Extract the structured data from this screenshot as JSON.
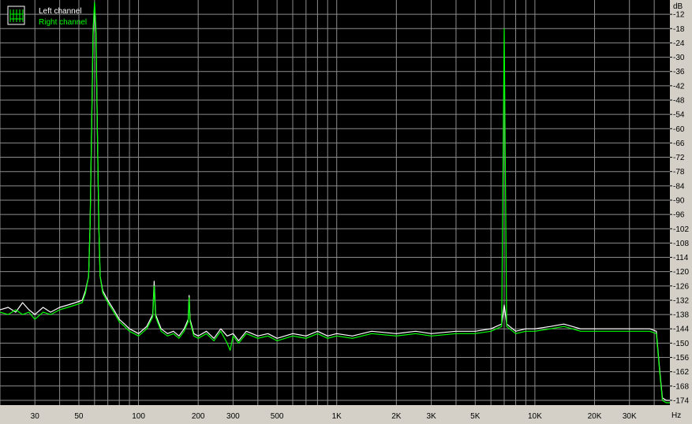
{
  "chart_data": {
    "type": "line",
    "title": "",
    "xlabel": "",
    "ylabel": "",
    "x_scale": "log",
    "xlim": [
      20,
      48000
    ],
    "ylim": [
      -176,
      -6
    ],
    "y_unit_label": "dB",
    "x_unit_label": "Hz",
    "grid": true,
    "background": "#000000",
    "legend_position": "top-left",
    "y_ticks": [
      -12,
      -18,
      -24,
      -30,
      -36,
      -42,
      -48,
      -54,
      -60,
      -66,
      -72,
      -78,
      -84,
      -90,
      -96,
      -102,
      -108,
      -114,
      -120,
      -126,
      -132,
      -138,
      -144,
      -150,
      -156,
      -162,
      -168,
      -174
    ],
    "x_ticks": [
      {
        "value": 30,
        "label": "30"
      },
      {
        "value": 50,
        "label": "50"
      },
      {
        "value": 100,
        "label": "100"
      },
      {
        "value": 200,
        "label": "200"
      },
      {
        "value": 300,
        "label": "300"
      },
      {
        "value": 500,
        "label": "500"
      },
      {
        "value": 1000,
        "label": "1K"
      },
      {
        "value": 2000,
        "label": "2K"
      },
      {
        "value": 3000,
        "label": "3K"
      },
      {
        "value": 5000,
        "label": "5K"
      },
      {
        "value": 10000,
        "label": "10K"
      },
      {
        "value": 20000,
        "label": "20K"
      },
      {
        "value": 30000,
        "label": "30K"
      }
    ],
    "minor_x_gridlines": [
      20,
      40,
      60,
      70,
      80,
      90,
      400,
      600,
      700,
      800,
      900,
      4000,
      6000,
      7000,
      8000,
      9000,
      40000
    ],
    "series": [
      {
        "name": "Left channel",
        "color": "#ffffff",
        "points": [
          [
            20,
            -136
          ],
          [
            22,
            -135
          ],
          [
            24,
            -137
          ],
          [
            26,
            -133
          ],
          [
            28,
            -136
          ],
          [
            30,
            -138
          ],
          [
            33,
            -135
          ],
          [
            36,
            -137
          ],
          [
            40,
            -135
          ],
          [
            44,
            -134
          ],
          [
            48,
            -133
          ],
          [
            52,
            -132
          ],
          [
            54,
            -128
          ],
          [
            56,
            -122
          ],
          [
            57,
            -100
          ],
          [
            58,
            -60
          ],
          [
            59,
            -20
          ],
          [
            60,
            -8
          ],
          [
            61,
            -20
          ],
          [
            62,
            -60
          ],
          [
            63,
            -100
          ],
          [
            64,
            -122
          ],
          [
            66,
            -128
          ],
          [
            70,
            -132
          ],
          [
            75,
            -136
          ],
          [
            80,
            -140
          ],
          [
            85,
            -142
          ],
          [
            90,
            -144
          ],
          [
            95,
            -145
          ],
          [
            100,
            -146
          ],
          [
            110,
            -143
          ],
          [
            118,
            -138
          ],
          [
            120,
            -124
          ],
          [
            122,
            -138
          ],
          [
            130,
            -144
          ],
          [
            140,
            -146
          ],
          [
            150,
            -145
          ],
          [
            160,
            -147
          ],
          [
            170,
            -144
          ],
          [
            178,
            -140
          ],
          [
            180,
            -130
          ],
          [
            182,
            -140
          ],
          [
            190,
            -146
          ],
          [
            200,
            -147
          ],
          [
            220,
            -145
          ],
          [
            240,
            -148
          ],
          [
            260,
            -144
          ],
          [
            280,
            -147
          ],
          [
            300,
            -146
          ],
          [
            320,
            -149
          ],
          [
            350,
            -145
          ],
          [
            400,
            -147
          ],
          [
            450,
            -146
          ],
          [
            500,
            -148
          ],
          [
            600,
            -146
          ],
          [
            700,
            -147
          ],
          [
            800,
            -145
          ],
          [
            900,
            -147
          ],
          [
            1000,
            -146
          ],
          [
            1200,
            -147
          ],
          [
            1500,
            -145
          ],
          [
            2000,
            -146
          ],
          [
            2500,
            -145
          ],
          [
            3000,
            -146
          ],
          [
            4000,
            -145
          ],
          [
            5000,
            -145
          ],
          [
            6000,
            -144
          ],
          [
            6800,
            -142
          ],
          [
            7000,
            -134
          ],
          [
            7200,
            -142
          ],
          [
            8000,
            -145
          ],
          [
            9000,
            -144
          ],
          [
            10000,
            -144
          ],
          [
            12000,
            -143
          ],
          [
            14000,
            -142
          ],
          [
            17000,
            -144
          ],
          [
            20000,
            -144
          ],
          [
            25000,
            -144
          ],
          [
            30000,
            -144
          ],
          [
            38000,
            -144
          ],
          [
            41000,
            -145
          ],
          [
            42500,
            -160
          ],
          [
            44000,
            -173
          ],
          [
            46000,
            -174
          ],
          [
            48000,
            -174
          ]
        ]
      },
      {
        "name": "Right channel",
        "color": "#00ff00",
        "points": [
          [
            20,
            -137
          ],
          [
            22,
            -138
          ],
          [
            24,
            -136
          ],
          [
            26,
            -138
          ],
          [
            28,
            -137
          ],
          [
            30,
            -140
          ],
          [
            33,
            -137
          ],
          [
            36,
            -138
          ],
          [
            40,
            -136
          ],
          [
            44,
            -135
          ],
          [
            48,
            -134
          ],
          [
            52,
            -133
          ],
          [
            54,
            -129
          ],
          [
            56,
            -122
          ],
          [
            57,
            -100
          ],
          [
            58,
            -60
          ],
          [
            59,
            -18
          ],
          [
            60,
            -7
          ],
          [
            61,
            -18
          ],
          [
            62,
            -60
          ],
          [
            63,
            -100
          ],
          [
            64,
            -122
          ],
          [
            66,
            -129
          ],
          [
            70,
            -133
          ],
          [
            75,
            -137
          ],
          [
            80,
            -141
          ],
          [
            85,
            -143
          ],
          [
            90,
            -145
          ],
          [
            95,
            -146
          ],
          [
            100,
            -147
          ],
          [
            110,
            -144
          ],
          [
            118,
            -139
          ],
          [
            120,
            -126
          ],
          [
            122,
            -139
          ],
          [
            130,
            -145
          ],
          [
            140,
            -147
          ],
          [
            150,
            -146
          ],
          [
            160,
            -148
          ],
          [
            170,
            -145
          ],
          [
            178,
            -141
          ],
          [
            180,
            -131
          ],
          [
            182,
            -141
          ],
          [
            190,
            -147
          ],
          [
            200,
            -148
          ],
          [
            220,
            -146
          ],
          [
            240,
            -149
          ],
          [
            260,
            -145
          ],
          [
            280,
            -150
          ],
          [
            290,
            -153
          ],
          [
            300,
            -147
          ],
          [
            320,
            -150
          ],
          [
            350,
            -146
          ],
          [
            400,
            -148
          ],
          [
            450,
            -147
          ],
          [
            500,
            -149
          ],
          [
            600,
            -147
          ],
          [
            700,
            -148
          ],
          [
            800,
            -146
          ],
          [
            900,
            -148
          ],
          [
            1000,
            -147
          ],
          [
            1200,
            -148
          ],
          [
            1500,
            -146
          ],
          [
            2000,
            -147
          ],
          [
            2500,
            -146
          ],
          [
            3000,
            -147
          ],
          [
            4000,
            -146
          ],
          [
            5000,
            -146
          ],
          [
            6000,
            -145
          ],
          [
            6800,
            -143
          ],
          [
            7000,
            -18
          ],
          [
            7200,
            -143
          ],
          [
            8000,
            -146
          ],
          [
            9000,
            -145
          ],
          [
            10000,
            -145
          ],
          [
            12000,
            -144
          ],
          [
            14000,
            -143
          ],
          [
            17000,
            -145
          ],
          [
            20000,
            -145
          ],
          [
            25000,
            -145
          ],
          [
            30000,
            -145
          ],
          [
            38000,
            -145
          ],
          [
            41000,
            -146
          ],
          [
            42500,
            -161
          ],
          [
            44000,
            -174
          ],
          [
            46000,
            -175
          ],
          [
            48000,
            -175
          ]
        ]
      }
    ]
  }
}
